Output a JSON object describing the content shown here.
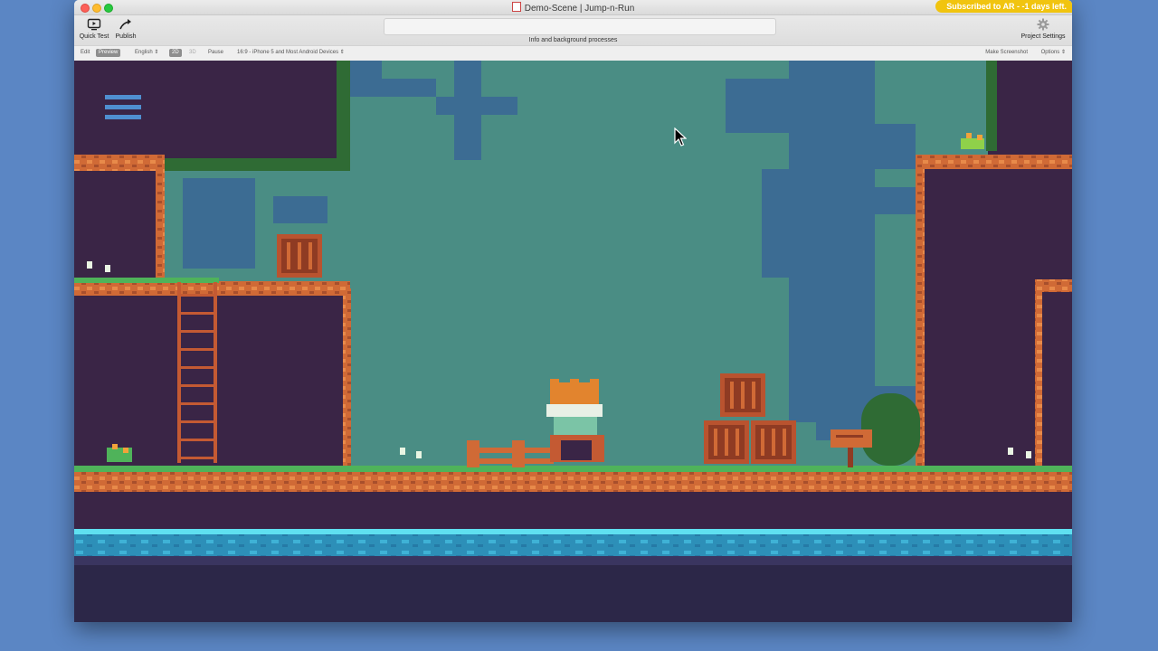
{
  "window": {
    "title": "Demo-Scene | Jump-n-Run",
    "subscription_badge": "Subscribed to AR - -1 days left."
  },
  "toolbar": {
    "quick_test_label": "Quick Test",
    "publish_label": "Publish",
    "info_label": "Info and background processes",
    "project_settings_label": "Project Settings"
  },
  "subbar": {
    "edit_label": "Edit",
    "preview_label": "Preview",
    "language_value": "English",
    "mode_2d_label": "2D",
    "mode_3d_label": "3D",
    "pause_label": "Pause",
    "device_value": "16:9 - iPhone 5 and Most Android Devices",
    "make_screenshot_label": "Make Screenshot",
    "options_label": "Options"
  },
  "game": {
    "menu_icon": "hamburger-menu-icon",
    "colors": {
      "sky": "#4a8d84",
      "tree_silhouette": "#3c6c93",
      "dirt_dark": "#3a2546",
      "dirt_edge": "#d06a36",
      "grass": "#4fb35a",
      "crate": "#b9532f",
      "water": "#35b8d5"
    }
  }
}
